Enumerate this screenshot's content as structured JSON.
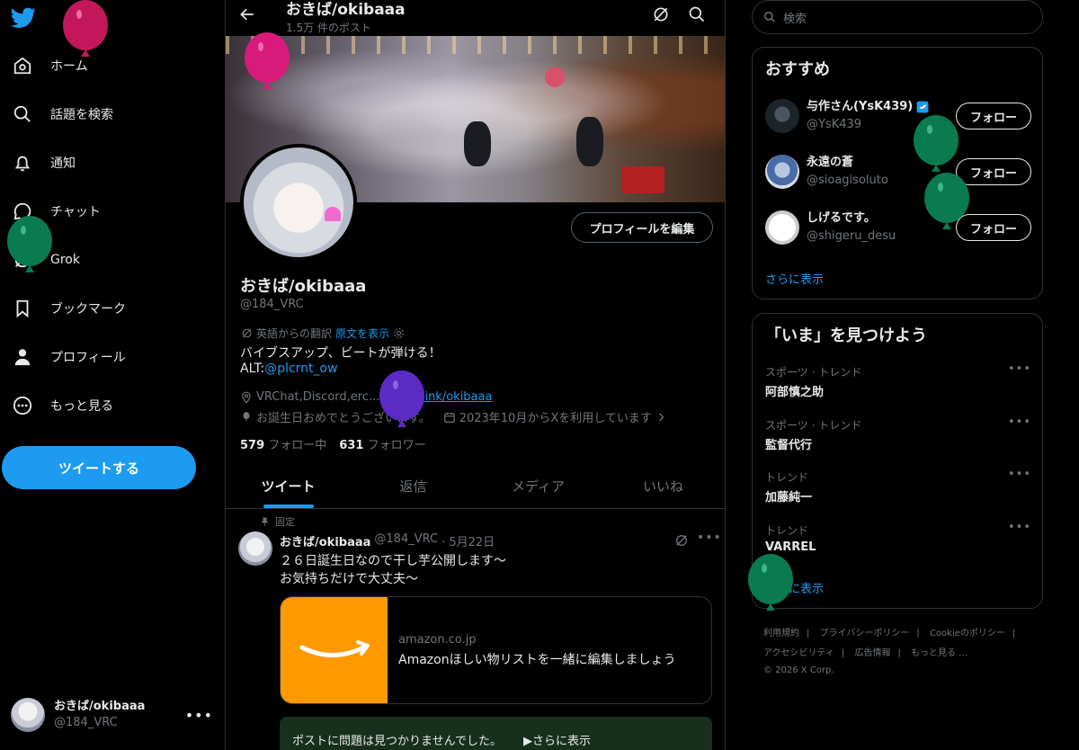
{
  "sidebar": {
    "items": [
      {
        "label": "ホーム",
        "icon": "home-icon"
      },
      {
        "label": "話題を検索",
        "icon": "search-icon"
      },
      {
        "label": "通知",
        "icon": "bell-icon"
      },
      {
        "label": "チャット",
        "icon": "chat-icon"
      },
      {
        "label": "Grok",
        "icon": "grok-icon"
      },
      {
        "label": "ブックマーク",
        "icon": "bookmark-icon"
      },
      {
        "label": "プロフィール",
        "icon": "person-icon"
      },
      {
        "label": "もっと見る",
        "icon": "more-circle-icon"
      }
    ],
    "tweet_button": "ツイートする",
    "account": {
      "name": "おきば/okibaaa",
      "handle": "@184_VRC"
    }
  },
  "profile": {
    "header_title": "おきば/okibaaa",
    "post_count": "1.5万 件のポスト",
    "name": "おきば/okibaaa",
    "handle": "@184_VRC",
    "edit_button": "プロフィールを編集",
    "translation_label": "英語からの翻訳",
    "show_original": "原文を表示",
    "bio_line1": "バイブスアップ、ビートが弾ける！",
    "bio_alt_prefix": "ALT:",
    "bio_alt_link": "@plcrnt_ow",
    "location": "VRChat,Discord,erc...",
    "website": "lit.link/okibaaa",
    "birthday": "お誕生日おめでとうございます。",
    "joined": "2023年10月からXを利用しています",
    "following_count": "579",
    "following_label": "フォロー中",
    "followers_count": "631",
    "followers_label": "フォロワー"
  },
  "tabs": [
    "ツイート",
    "返信",
    "メディア",
    "いいね"
  ],
  "tweet": {
    "pinned_label": "固定",
    "author_name": "おきば/okibaaa",
    "author_handle": "@184_VRC",
    "date": "· 5月22日",
    "line1": "２６日誕生日なので干し芋公開します～",
    "line2": "お気持ちだけで大丈夫～",
    "card_domain": "amazon.co.jp",
    "card_title": "Amazonほしい物リストを一緒に編集しましょう",
    "notice_text": "ポストに問題は見つかりませんでした。",
    "notice_more": "▶さらに表示"
  },
  "right": {
    "search_placeholder": "検索",
    "recommend_title": "おすすめ",
    "recommend": [
      {
        "name": "与作さん(YsK439)",
        "handle": "@YsK439",
        "follow": "フォロー",
        "verified": true
      },
      {
        "name": "永遠の蒼",
        "handle": "@sioagisoluto",
        "follow": "フォロー",
        "verified": false
      },
      {
        "name": "しげるです。",
        "handle": "@shigeru_desu",
        "follow": "フォロー",
        "verified": false
      }
    ],
    "recommend_more": "さらに表示",
    "trends_title": "「いま」を見つけよう",
    "trends": [
      {
        "category": "スポーツ · トレンド",
        "name": "阿部慎之助"
      },
      {
        "category": "スポーツ · トレンド",
        "name": "監督代行"
      },
      {
        "category": "トレンド",
        "name": "加藤純一"
      },
      {
        "category": "トレンド",
        "name": "VARREL"
      }
    ],
    "trends_more": "さらに表示",
    "footer": {
      "terms": "利用規約",
      "privacy": "プライバシーポリシー",
      "cookie": "Cookieのポリシー",
      "accessibility": "アクセシビリティ",
      "ads": "広告情報",
      "more": "もっと見る …",
      "copyright": "© 2026 X Corp."
    }
  },
  "colors": {
    "accent": "#1d9bf0",
    "background": "#000000",
    "muted": "#71767b",
    "balloon_pink": "#c2185b",
    "balloon_green": "#0a7a50",
    "balloon_purple": "#5b2bc4"
  }
}
